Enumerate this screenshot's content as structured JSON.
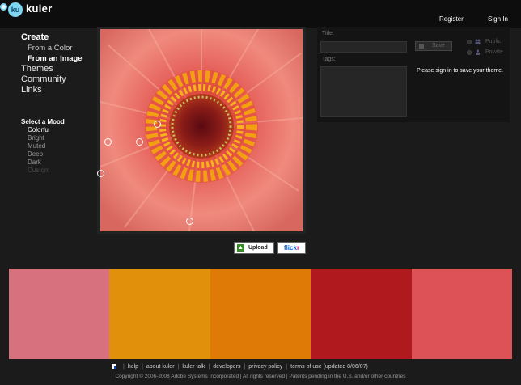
{
  "header": {
    "app_name": "kuler",
    "logo_badge": "ku",
    "register_label": "Register",
    "signin_label": "Sign In"
  },
  "nav": {
    "create_label": "Create",
    "create_sub": [
      "From a Color",
      "From an Image"
    ],
    "themes_label": "Themes",
    "community_label": "Community",
    "links_label": "Links"
  },
  "mood": {
    "title": "Select a Mood",
    "items": [
      "Colorful",
      "Bright",
      "Muted",
      "Deep",
      "Dark",
      "Custom"
    ],
    "selected": "Colorful"
  },
  "image_area": {
    "upload_label": "Upload",
    "flickr_part1": "flick",
    "flickr_part2": "r"
  },
  "theme_panel": {
    "title_label": "Title:",
    "tags_label": "Tags:",
    "save_label": "Save",
    "public_label": "Public",
    "private_label": "Private",
    "signin_message": "Please sign in to save your theme."
  },
  "swatches": [
    "#d8717e",
    "#e0900a",
    "#e07a06",
    "#b01a1e",
    "#dc5256"
  ],
  "footer": {
    "links": [
      "help",
      "about kuler",
      "kuler talk",
      "developers",
      "privacy policy",
      "terms of use (updated 8/06/07)"
    ],
    "copyright": "Copyright © 2006-2008 Adobe Systems Incorporated | All rights reserved | Patents pending in the U.S. and/or other countries"
  }
}
